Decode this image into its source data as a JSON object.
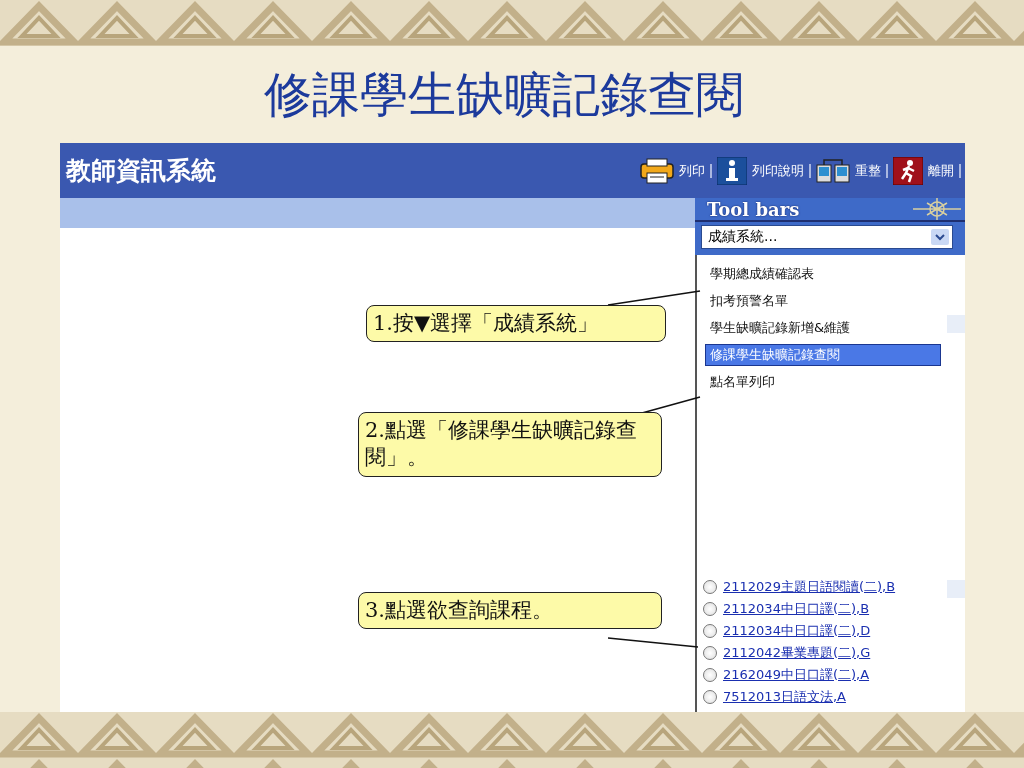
{
  "slide": {
    "title": "修課學生缺曠記錄查閱"
  },
  "app": {
    "title": "教師資訊系統",
    "toolbar": [
      {
        "kind": "print",
        "label": "列印"
      },
      {
        "kind": "info",
        "label": "列印說明"
      },
      {
        "kind": "refresh",
        "label": "重整"
      },
      {
        "kind": "exit",
        "label": "離開"
      }
    ],
    "panel": {
      "title": "Tool bars",
      "dropdown": {
        "value": "成績系統..."
      },
      "menu": [
        {
          "label": "學期總成績確認表",
          "selected": false
        },
        {
          "label": "扣考預警名單",
          "selected": false
        },
        {
          "label": "學生缺曠記錄新增&維護",
          "selected": false
        },
        {
          "label": "修課學生缺曠記錄查閱",
          "selected": true
        },
        {
          "label": "點名單列印",
          "selected": false
        }
      ],
      "courses": [
        {
          "label": "2112029主題日語閱讀(二),B",
          "selected": false
        },
        {
          "label": "2112034中日口譯(二),B",
          "selected": false
        },
        {
          "label": "2112034中日口譯(二),D",
          "selected": false
        },
        {
          "label": "2112042畢業專題(二),G",
          "selected": false
        },
        {
          "label": "2162049中日口譯(二),A",
          "selected": false
        },
        {
          "label": "7512013日語文法,A",
          "selected": false
        }
      ]
    }
  },
  "callouts": [
    {
      "text": "1.按▼選擇「成績系統」"
    },
    {
      "text": "2.點選「修課學生缺曠記錄查閱」。"
    },
    {
      "text": "3.點選欲查詢課程。"
    }
  ]
}
